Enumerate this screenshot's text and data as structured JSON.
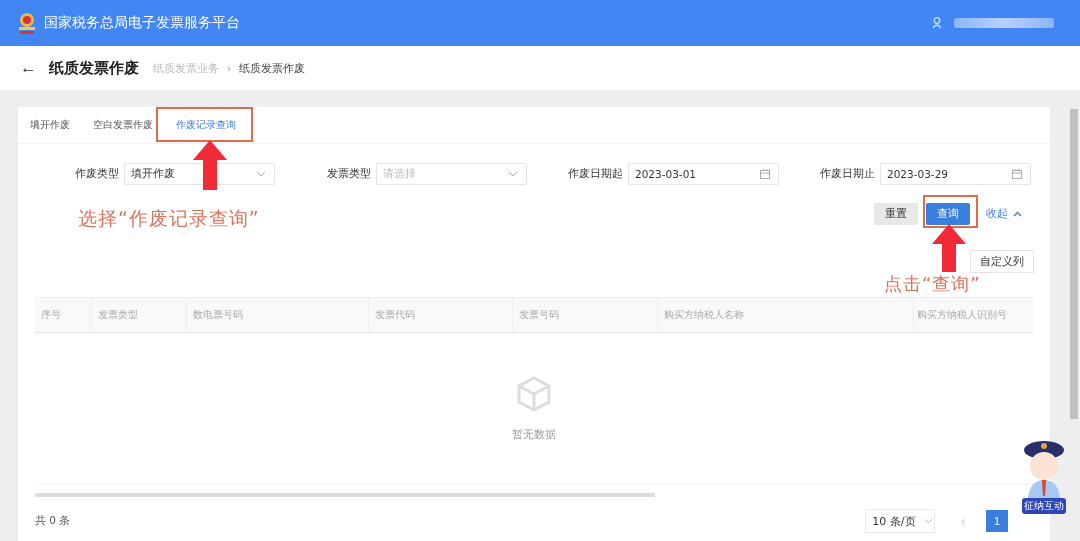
{
  "header": {
    "title": "国家税务总局电子发票服务平台"
  },
  "page": {
    "back": "←",
    "title": "纸质发票作废",
    "separator": "›",
    "breadcrumb": [
      {
        "label": "纸质发票业务",
        "current": false
      },
      {
        "label": "纸质发票作废",
        "current": true
      }
    ]
  },
  "tabs": [
    {
      "label": "填开作废",
      "selected": false
    },
    {
      "label": "空白发票作废",
      "selected": false
    },
    {
      "label": "作废记录查询",
      "selected": true
    }
  ],
  "filters": [
    {
      "label": "作废类型",
      "kind": "select",
      "value": "填开作废"
    },
    {
      "label": "发票类型",
      "kind": "select",
      "placeholder": "请选择"
    },
    {
      "label": "作废日期起",
      "kind": "date",
      "value": "2023-03-01"
    },
    {
      "label": "作废日期止",
      "kind": "date",
      "value": "2023-03-29"
    }
  ],
  "actions": {
    "reset": "重置",
    "query": "查询",
    "collapse": "收起"
  },
  "custom_columns": "自定义列",
  "table": {
    "columns": [
      "序号",
      "发票类型",
      "数电票号码",
      "发票代码",
      "发票号码",
      "购买方纳税人名称",
      "购买方纳税人识别号"
    ],
    "empty_text": "暂无数据"
  },
  "footer": {
    "total": "共 0 条",
    "page_size": "10 条/页",
    "prev": "‹",
    "pages": [
      {
        "label": "1",
        "selected": true
      }
    ]
  },
  "annotations": [
    {
      "text": "选择“作废记录查询”"
    },
    {
      "text": "点击“查询”"
    }
  ],
  "mascot": {
    "badge": "征纳互动"
  }
}
